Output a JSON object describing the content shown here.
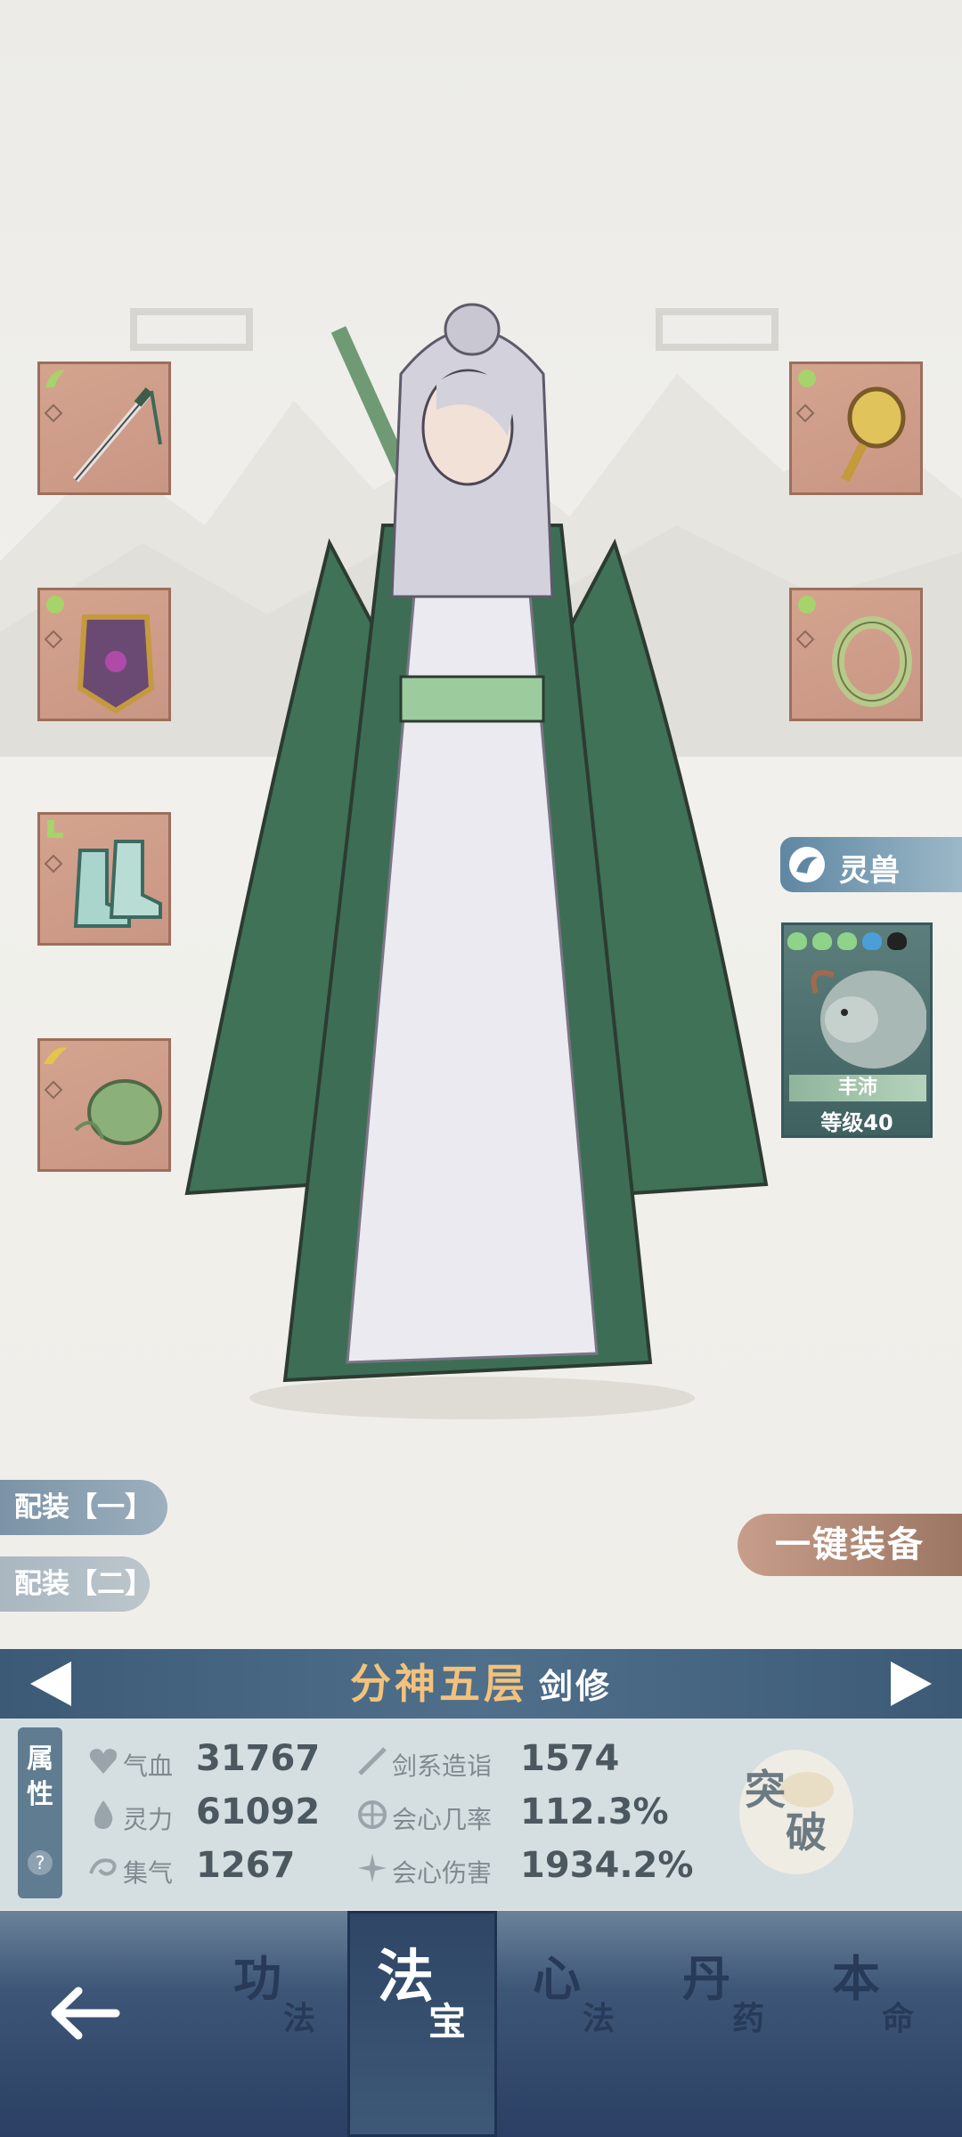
{
  "pet": {
    "section_label": "灵兽",
    "name": "丰沛",
    "level": "等级40",
    "star_colors": [
      "#8fd38b",
      "#8fd38b",
      "#8fd38b",
      "#4a9fd8",
      "#222222"
    ]
  },
  "loadouts": [
    "配装【一】",
    "配装【二】"
  ],
  "equip_all_label": "一键装备",
  "realm": {
    "stage": "分神五层",
    "class": "剑修"
  },
  "attributes_tab": {
    "line1": "属",
    "line2": "性",
    "help": "?"
  },
  "stats": [
    {
      "icon": "heart-icon",
      "label": "气血",
      "value": "31767"
    },
    {
      "icon": "sword-icon",
      "label": "剑系造诣",
      "value": "1574"
    },
    {
      "icon": "drop-icon",
      "label": "灵力",
      "value": "61092"
    },
    {
      "icon": "crit-icon",
      "label": "会心几率",
      "value": "112.3%"
    },
    {
      "icon": "swirl-icon",
      "label": "集气",
      "value": "1267"
    },
    {
      "icon": "burst-icon",
      "label": "会心伤害",
      "value": "1934.2%"
    }
  ],
  "breakthrough": {
    "char1": "突",
    "char2": "破"
  },
  "nav": [
    {
      "c1": "功",
      "c2": "法",
      "active": false
    },
    {
      "c1": "法",
      "c2": "宝",
      "active": true
    },
    {
      "c1": "心",
      "c2": "法",
      "active": false
    },
    {
      "c1": "丹",
      "c2": "药",
      "active": false
    },
    {
      "c1": "本",
      "c2": "命",
      "active": false
    }
  ],
  "colors": {
    "realm_gold": "#f2c27d",
    "slot_bg": "#d0a08c",
    "nav_dark": "#2a3f63"
  }
}
